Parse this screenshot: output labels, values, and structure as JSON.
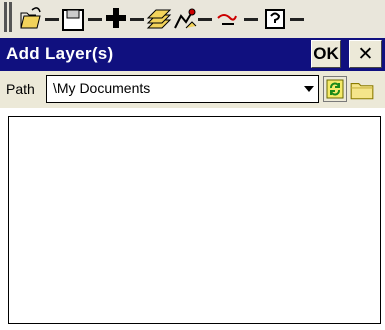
{
  "dialog": {
    "title": "Add Layer(s)",
    "ok_label": "OK",
    "close_label": "✕"
  },
  "path": {
    "label": "Path",
    "value": "\\My Documents"
  },
  "toolbar": {
    "icons": [
      "open-file-icon",
      "save-icon",
      "add-icon",
      "layers-icon",
      "draw-icon",
      "tools-icon",
      "help-icon"
    ]
  },
  "colors": {
    "titlebar": "#10107f",
    "window": "#ece9d8",
    "list_background": "#ffffff"
  },
  "layers_list": []
}
